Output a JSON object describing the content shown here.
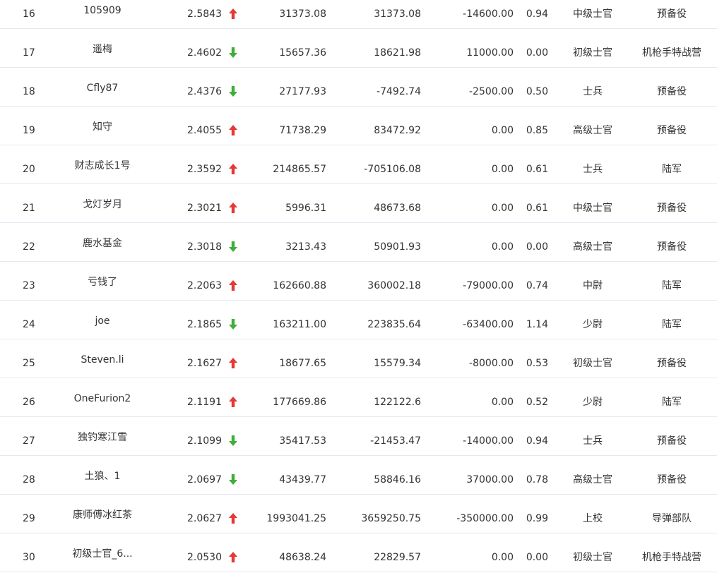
{
  "colors": {
    "up": "#e53935",
    "down": "#3fae3a",
    "text": "#333333",
    "row_border": "#e3e9f1"
  },
  "rows": [
    {
      "rank": "16",
      "name": "105909",
      "score": "2.5843",
      "trend": "up",
      "c1": "31373.08",
      "c2": "31373.08",
      "c3": "-14600.00",
      "c4": "0.94",
      "level": "中级士官",
      "group": "预备役"
    },
    {
      "rank": "17",
      "name": "遥梅",
      "score": "2.4602",
      "trend": "down",
      "c1": "15657.36",
      "c2": "18621.98",
      "c3": "11000.00",
      "c4": "0.00",
      "level": "初级士官",
      "group": "机枪手特战营"
    },
    {
      "rank": "18",
      "name": "Cfly87",
      "score": "2.4376",
      "trend": "down",
      "c1": "27177.93",
      "c2": "-7492.74",
      "c3": "-2500.00",
      "c4": "0.50",
      "level": "士兵",
      "group": "预备役"
    },
    {
      "rank": "19",
      "name": "知守",
      "score": "2.4055",
      "trend": "up",
      "c1": "71738.29",
      "c2": "83472.92",
      "c3": "0.00",
      "c4": "0.85",
      "level": "高级士官",
      "group": "预备役"
    },
    {
      "rank": "20",
      "name": "财志成长1号",
      "score": "2.3592",
      "trend": "up",
      "c1": "214865.57",
      "c2": "-705106.08",
      "c3": "0.00",
      "c4": "0.61",
      "level": "士兵",
      "group": "陆军"
    },
    {
      "rank": "21",
      "name": "戈灯岁月",
      "score": "2.3021",
      "trend": "up",
      "c1": "5996.31",
      "c2": "48673.68",
      "c3": "0.00",
      "c4": "0.61",
      "level": "中级士官",
      "group": "预备役"
    },
    {
      "rank": "22",
      "name": "鹿水基金",
      "score": "2.3018",
      "trend": "down",
      "c1": "3213.43",
      "c2": "50901.93",
      "c3": "0.00",
      "c4": "0.00",
      "level": "高级士官",
      "group": "预备役"
    },
    {
      "rank": "23",
      "name": "亏钱了",
      "score": "2.2063",
      "trend": "up",
      "c1": "162660.88",
      "c2": "360002.18",
      "c3": "-79000.00",
      "c4": "0.74",
      "level": "中尉",
      "group": "陆军"
    },
    {
      "rank": "24",
      "name": "joe",
      "score": "2.1865",
      "trend": "down",
      "c1": "163211.00",
      "c2": "223835.64",
      "c3": "-63400.00",
      "c4": "1.14",
      "level": "少尉",
      "group": "陆军"
    },
    {
      "rank": "25",
      "name": "Steven.li",
      "score": "2.1627",
      "trend": "up",
      "c1": "18677.65",
      "c2": "15579.34",
      "c3": "-8000.00",
      "c4": "0.53",
      "level": "初级士官",
      "group": "预备役"
    },
    {
      "rank": "26",
      "name": "OneFurion2",
      "score": "2.1191",
      "trend": "up",
      "c1": "177669.86",
      "c2": "122122.6",
      "c3": "0.00",
      "c4": "0.52",
      "level": "少尉",
      "group": "陆军"
    },
    {
      "rank": "27",
      "name": "独钓寒江雪",
      "score": "2.1099",
      "trend": "down",
      "c1": "35417.53",
      "c2": "-21453.47",
      "c3": "-14000.00",
      "c4": "0.94",
      "level": "士兵",
      "group": "预备役"
    },
    {
      "rank": "28",
      "name": "土狼、1",
      "score": "2.0697",
      "trend": "down",
      "c1": "43439.77",
      "c2": "58846.16",
      "c3": "37000.00",
      "c4": "0.78",
      "level": "高级士官",
      "group": "预备役"
    },
    {
      "rank": "29",
      "name": "康师傅冰红茶",
      "score": "2.0627",
      "trend": "up",
      "c1": "1993041.25",
      "c2": "3659250.75",
      "c3": "-350000.00",
      "c4": "0.99",
      "level": "上校",
      "group": "导弹部队"
    },
    {
      "rank": "30",
      "name": "初级士官_6...",
      "score": "2.0530",
      "trend": "up",
      "c1": "48638.24",
      "c2": "22829.57",
      "c3": "0.00",
      "c4": "0.00",
      "level": "初级士官",
      "group": "机枪手特战营"
    }
  ]
}
